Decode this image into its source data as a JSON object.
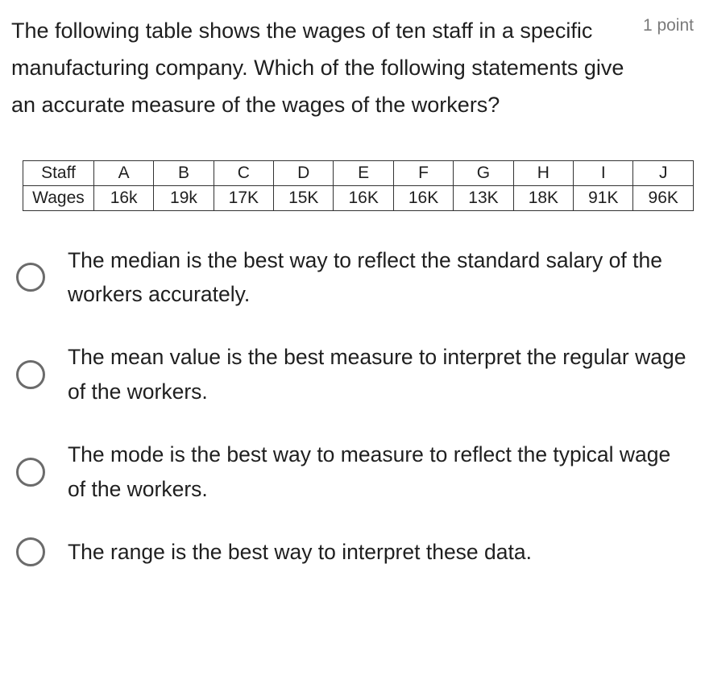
{
  "question": "The following table shows the wages of ten staff in a specific manufacturing company. Which of the following statements give an accurate measure of the wages of the workers?",
  "points": "1 point",
  "table": {
    "headers": [
      "Staff",
      "A",
      "B",
      "C",
      "D",
      "E",
      "F",
      "G",
      "H",
      "I",
      "J"
    ],
    "row_label": "Wages",
    "row_values": [
      "16k",
      "19k",
      "17K",
      "15K",
      "16K",
      "16K",
      "13K",
      "18K",
      "91K",
      "96K"
    ]
  },
  "options": [
    "The median is the best way to reflect the standard salary of the workers accurately.",
    "The mean value is the best measure to interpret the regular wage of the workers.",
    "The mode is the best way to measure to reflect the typical wage of the workers.",
    "The range is the best way to interpret these data."
  ]
}
